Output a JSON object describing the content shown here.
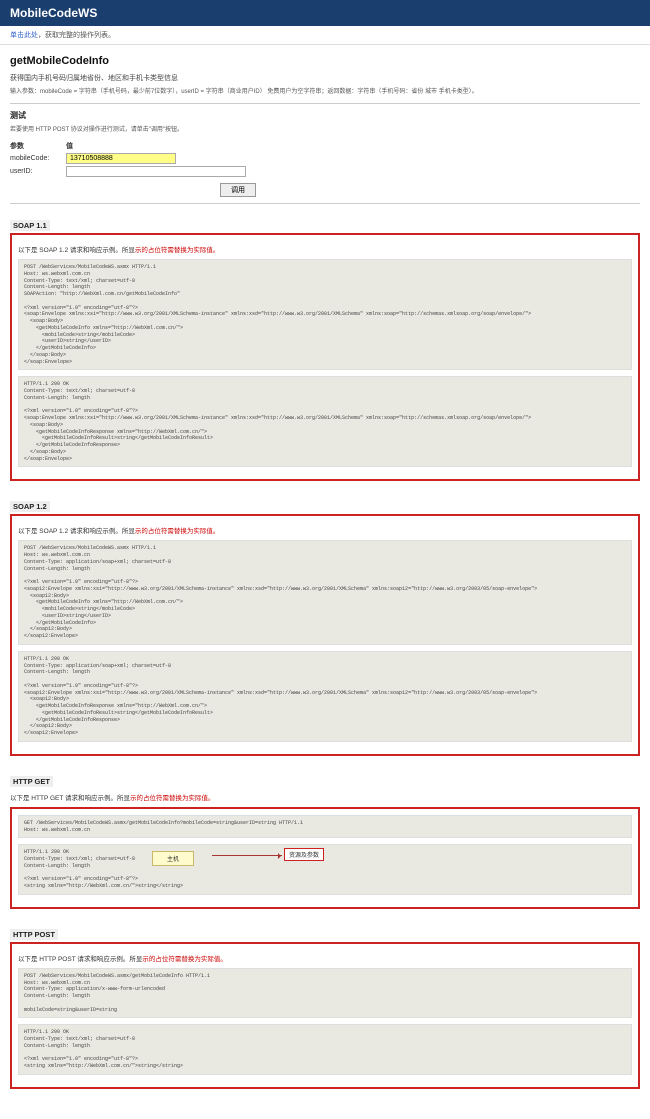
{
  "topbar": {
    "title": "MobileCodeWS"
  },
  "crumbs": {
    "link": "单击此处",
    "rest": "，获取完整的操作列表。"
  },
  "page": {
    "title": "getMobileCodeInfo",
    "desc": "获得国内手机号码归属地省份、地区和手机卡类型信息",
    "subdesc": "输入参数：mobileCode = 字符串（手机号码，最少前7位数字），userID = 字符串（商业用户ID） 免费用户为空字符串；返回数据：字符串（手机号码：省份 城市 手机卡类型）。"
  },
  "test": {
    "heading": "测试",
    "note": "若要使用 HTTP POST 协议对操作进行测试，请单击\"调用\"按钮。",
    "paramcol": "参数",
    "valuecol": "值",
    "mobile_label": "mobileCode:",
    "mobile_value": "13710508888",
    "user_label": "userID:",
    "user_value": "",
    "btn": "调用"
  },
  "sections": {
    "soap11": {
      "label": "SOAP 1.1",
      "intro_plain": "以下是 SOAP 1.2 请求和响应示例。所显",
      "intro_red": "示的占位符需替换为实际值。",
      "req": "POST /WebServices/MobileCodeWS.asmx HTTP/1.1\nHost: ws.webxml.com.cn\nContent-Type: text/xml; charset=utf-8\nContent-Length: length\nSOAPAction: \"http://WebXml.com.cn/getMobileCodeInfo\"\n\n<?xml version=\"1.0\" encoding=\"utf-8\"?>\n<soap:Envelope xmlns:xsi=\"http://www.w3.org/2001/XMLSchema-instance\" xmlns:xsd=\"http://www.w3.org/2001/XMLSchema\" xmlns:soap=\"http://schemas.xmlsoap.org/soap/envelope/\">\n  <soap:Body>\n    <getMobileCodeInfo xmlns=\"http://WebXml.com.cn/\">\n      <mobileCode>string</mobileCode>\n      <userID>string</userID>\n    </getMobileCodeInfo>\n  </soap:Body>\n</soap:Envelope>",
      "res": "HTTP/1.1 200 OK\nContent-Type: text/xml; charset=utf-8\nContent-Length: length\n\n<?xml version=\"1.0\" encoding=\"utf-8\"?>\n<soap:Envelope xmlns:xsi=\"http://www.w3.org/2001/XMLSchema-instance\" xmlns:xsd=\"http://www.w3.org/2001/XMLSchema\" xmlns:soap=\"http://schemas.xmlsoap.org/soap/envelope/\">\n  <soap:Body>\n    <getMobileCodeInfoResponse xmlns=\"http://WebXml.com.cn/\">\n      <getMobileCodeInfoResult>string</getMobileCodeInfoResult>\n    </getMobileCodeInfoResponse>\n  </soap:Body>\n</soap:Envelope>"
    },
    "soap12": {
      "label": "SOAP 1.2",
      "intro_plain": "以下是 SOAP 1.2 请求和响应示例。所显",
      "intro_red": "示的占位符需替换为实际值。",
      "req": "POST /WebServices/MobileCodeWS.asmx HTTP/1.1\nHost: ws.webxml.com.cn\nContent-Type: application/soap+xml; charset=utf-8\nContent-Length: length\n\n<?xml version=\"1.0\" encoding=\"utf-8\"?>\n<soap12:Envelope xmlns:xsi=\"http://www.w3.org/2001/XMLSchema-instance\" xmlns:xsd=\"http://www.w3.org/2001/XMLSchema\" xmlns:soap12=\"http://www.w3.org/2003/05/soap-envelope\">\n  <soap12:Body>\n    <getMobileCodeInfo xmlns=\"http://WebXml.com.cn/\">\n      <mobileCode>string</mobileCode>\n      <userID>string</userID>\n    </getMobileCodeInfo>\n  </soap12:Body>\n</soap12:Envelope>",
      "res": "HTTP/1.1 200 OK\nContent-Type: application/soap+xml; charset=utf-8\nContent-Length: length\n\n<?xml version=\"1.0\" encoding=\"utf-8\"?>\n<soap12:Envelope xmlns:xsi=\"http://www.w3.org/2001/XMLSchema-instance\" xmlns:xsd=\"http://www.w3.org/2001/XMLSchema\" xmlns:soap12=\"http://www.w3.org/2003/05/soap-envelope\">\n  <soap12:Body>\n    <getMobileCodeInfoResponse xmlns=\"http://WebXml.com.cn/\">\n      <getMobileCodeInfoResult>string</getMobileCodeInfoResult>\n    </getMobileCodeInfoResponse>\n  </soap12:Body>\n</soap12:Envelope>"
    },
    "httpget": {
      "label": "HTTP GET",
      "intro_plain": "以下是 HTTP GET 请求和响应示例。所显",
      "intro_red": "示的占位符需替换为实际值。",
      "req": "GET /WebServices/MobileCodeWS.asmx/getMobileCodeInfo?mobileCode=string&userID=string HTTP/1.1\nHost: ws.webxml.com.cn",
      "res": "HTTP/1.1 200 OK\nContent-Type: text/xml; charset=utf-8\nContent-Length: length\n\n<?xml version=\"1.0\" encoding=\"utf-8\"?>\n<string xmlns=\"http://WebXml.com.cn/\">string</string>",
      "annot_host": "主机",
      "annot_param": "资源及参数"
    },
    "httppost": {
      "label": "HTTP POST",
      "intro_plain": "以下是 HTTP POST 请求和响应示例。所显",
      "intro_red": "示的占位符需替换为实际值。",
      "req": "POST /WebServices/MobileCodeWS.asmx/getMobileCodeInfo HTTP/1.1\nHost: ws.webxml.com.cn\nContent-Type: application/x-www-form-urlencoded\nContent-Length: length\n\nmobileCode=string&userID=string",
      "res": "HTTP/1.1 200 OK\nContent-Type: text/xml; charset=utf-8\nContent-Length: length\n\n<?xml version=\"1.0\" encoding=\"utf-8\"?>\n<string xmlns=\"http://WebXml.com.cn/\">string</string>"
    }
  }
}
